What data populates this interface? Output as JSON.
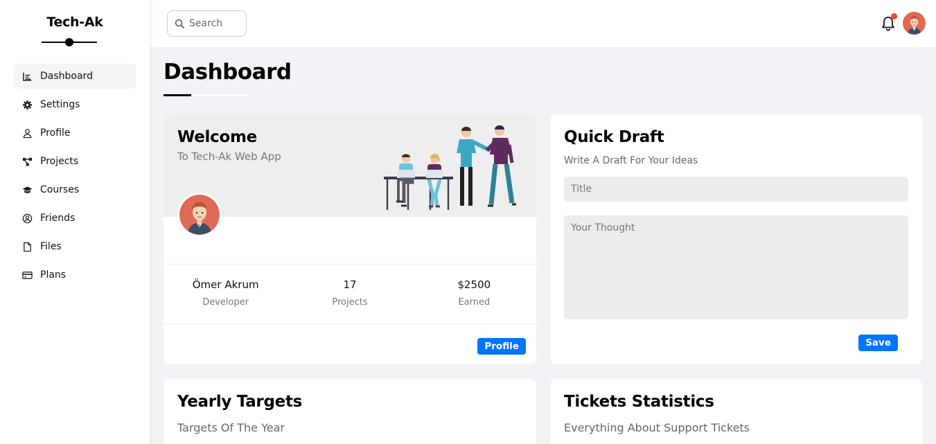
{
  "sidebar": {
    "brand": "Tech-Ak",
    "items": [
      {
        "label": "Dashboard",
        "icon": "chart-icon",
        "active": true
      },
      {
        "label": "Settings",
        "icon": "gear-icon"
      },
      {
        "label": "Profile",
        "icon": "user-icon"
      },
      {
        "label": "Projects",
        "icon": "diagram-icon"
      },
      {
        "label": "Courses",
        "icon": "graduation-cap-icon"
      },
      {
        "label": "Friends",
        "icon": "user-circle-icon"
      },
      {
        "label": "Files",
        "icon": "file-icon"
      },
      {
        "label": "Plans",
        "icon": "credit-card-icon"
      }
    ]
  },
  "topbar": {
    "search_placeholder": "Search",
    "notification_badge_color": "#f44336"
  },
  "page": {
    "title": "Dashboard"
  },
  "welcome": {
    "title": "Welcome",
    "subtitle": "To Tech-Ak Web App",
    "stats": [
      {
        "value": "Ömer Akrum",
        "label": "Developer"
      },
      {
        "value": "17",
        "label": "Projects"
      },
      {
        "value": "$2500",
        "label": "Earned"
      }
    ],
    "button": "Profile"
  },
  "draft": {
    "title": "Quick Draft",
    "subtitle": "Write A Draft For Your Ideas",
    "title_placeholder": "Title",
    "thought_placeholder": "Your Thought",
    "button": "Save"
  },
  "targets": {
    "title": "Yearly Targets",
    "subtitle": "Targets Of The Year"
  },
  "tickets": {
    "title": "Tickets Statistics",
    "subtitle": "Everything About Support Tickets"
  },
  "colors": {
    "accent": "#0075ff",
    "background": "#f1f3f7",
    "hero": "#eeeeee"
  }
}
